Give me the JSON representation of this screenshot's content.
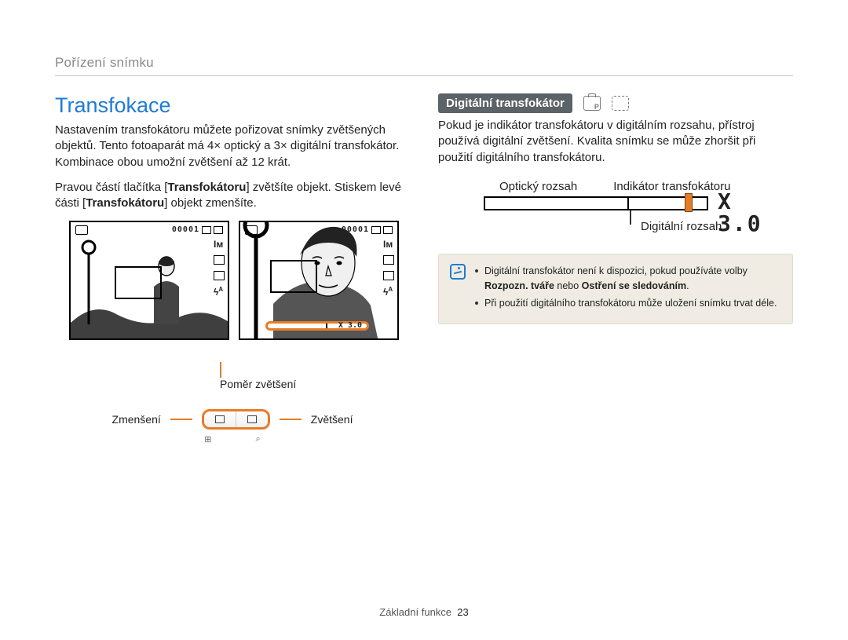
{
  "breadcrumb": "Pořízení snímku",
  "left": {
    "title": "Transfokace",
    "intro": "Nastavením transfokátoru můžete pořizovat snímky zvětšených objektů. Tento fotoaparát má 4× optický a 3× digitální transfokátor. Kombinace obou umožní zvětšení až 12 krát.",
    "instr_pre": "Pravou částí tlačítka [",
    "instr_bold1": "Transfokátoru",
    "instr_mid": "] zvětšíte objekt. Stiskem levé části [",
    "instr_bold2": "Transfokátoru",
    "instr_post": "] objekt zmenšíte.",
    "lcd_counter": "00001",
    "lcd_zoom_text": "X 3.0",
    "ratio_caption": "Poměr zvětšení",
    "zoom_out": "Zmenšení",
    "zoom_in": "Zvětšení",
    "thumb_glyph": "⊞",
    "mag_glyph": "⌕"
  },
  "right": {
    "tag": "Digitální transfokátor",
    "mode_p": "P",
    "para": "Pokud je indikátor transfokátoru v digitálním rozsahu, přístroj používá digitální zvětšení. Kvalita snímku se může zhoršit při použití digitálního transfokátoru.",
    "optical_label": "Optický rozsah",
    "indicator_label": "Indikátor transfokátoru",
    "digital_label": "Digitální rozsah",
    "zoom_mult": "X 3.0",
    "note1_pre": "Digitální transfokátor není k dispozici, pokud používáte volby ",
    "note1_b1": "Rozpozn. tváře",
    "note1_mid": " nebo ",
    "note1_b2": "Ostření se sledováním",
    "note1_post": ".",
    "note2": "Při použití digitálního transfokátoru může uložení snímku trvat déle."
  },
  "footer": {
    "section": "Základní funkce",
    "pagenum": "23"
  }
}
